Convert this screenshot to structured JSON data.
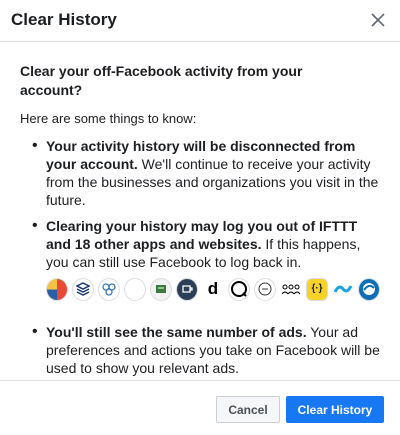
{
  "dialog": {
    "title": "Clear History",
    "question": "Clear your off-Facebook activity from your account?",
    "intro": "Here are some things to know:",
    "points": [
      {
        "bold": "Your activity history will be disconnected from your account.",
        "text": " We'll continue to receive your activity from the businesses and organizations you visit in the future."
      },
      {
        "bold": "Clearing your history may log you out of IFTTT and 18 other apps and websites.",
        "text": " If this happens, you can still use Facebook to log back in."
      },
      {
        "bold": "You'll still see the same number of ads.",
        "text": " Your ad preferences and actions you take on Facebook will be used to show you relevant ads."
      }
    ],
    "apps": [
      {
        "icon": "app-icon-1"
      },
      {
        "icon": "app-icon-2"
      },
      {
        "icon": "app-icon-3"
      },
      {
        "icon": "app-icon-4"
      },
      {
        "icon": "app-icon-5"
      },
      {
        "icon": "app-icon-6"
      },
      {
        "icon": "app-icon-7"
      },
      {
        "icon": "app-icon-8"
      },
      {
        "icon": "app-icon-9"
      },
      {
        "icon": "app-icon-10"
      },
      {
        "icon": "app-icon-11"
      },
      {
        "icon": "app-icon-12"
      },
      {
        "icon": "app-icon-13"
      }
    ],
    "cancel_label": "Cancel",
    "confirm_label": "Clear History",
    "colors": {
      "primary": "#1877f2",
      "text": "#1c1e21"
    }
  }
}
